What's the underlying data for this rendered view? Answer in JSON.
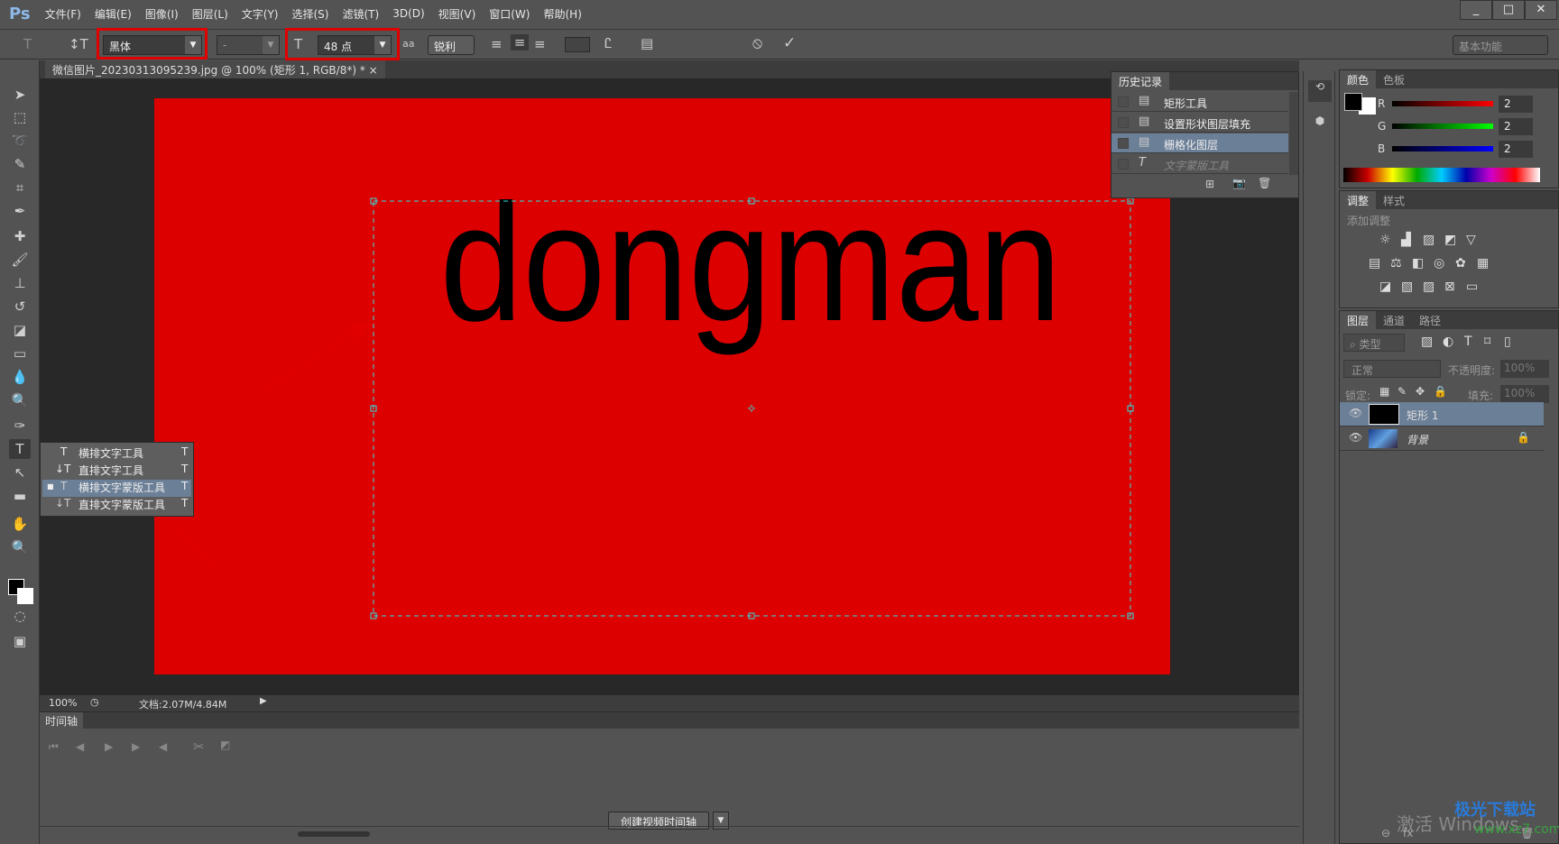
{
  "app": {
    "logo": "Ps"
  },
  "menu": [
    "文件(F)",
    "编辑(E)",
    "图像(I)",
    "图层(L)",
    "文字(Y)",
    "选择(S)",
    "滤镜(T)",
    "3D(D)",
    "视图(V)",
    "窗口(W)",
    "帮助(H)"
  ],
  "window_controls": {
    "minimize": "_",
    "maximize": "□",
    "close": "✕"
  },
  "options": {
    "font_family": "黑体",
    "font_style": "-",
    "font_size": "48 点",
    "antialias_icon": "aa",
    "antialias": "锐利",
    "workspace": "基本功能",
    "cancel": "⦸",
    "commit": "✓"
  },
  "document": {
    "tab_title": "微信图片_20230313095239.jpg @ 100% (矩形 1, RGB/8*) *",
    "tab_close": "×",
    "text": "dongman",
    "canvas_color": "#dc0000"
  },
  "status": {
    "zoom": "100%",
    "doc_size": "文档:2.07M/4.84M"
  },
  "timeline": {
    "tab": "时间轴",
    "create_button": "创建视频时间轴"
  },
  "tool_flyout": {
    "items": [
      {
        "icon": "T",
        "label": "横排文字工具",
        "key": "T",
        "selected": false
      },
      {
        "icon": "↓T",
        "label": "直排文字工具",
        "key": "T",
        "selected": false
      },
      {
        "icon": "T",
        "label": "横排文字蒙版工具",
        "key": "T",
        "selected": true
      },
      {
        "icon": "↓T",
        "label": "直排文字蒙版工具",
        "key": "T",
        "selected": false
      }
    ]
  },
  "history": {
    "title": "历史记录",
    "items": [
      {
        "label": "矩形工具",
        "selected": false
      },
      {
        "label": "设置形状图层填充",
        "selected": false
      },
      {
        "label": "栅格化图层",
        "selected": true
      },
      {
        "label": "文字蒙版工具",
        "selected": false,
        "disabled": true
      }
    ]
  },
  "color_panel": {
    "tabs": [
      "颜色",
      "色板"
    ],
    "channels": [
      {
        "name": "R",
        "value": "2"
      },
      {
        "name": "G",
        "value": "2"
      },
      {
        "name": "B",
        "value": "2"
      }
    ]
  },
  "adjust_panel": {
    "tabs": [
      "调整",
      "样式"
    ],
    "heading": "添加调整"
  },
  "layers_panel": {
    "tabs": [
      "图层",
      "通道",
      "路径"
    ],
    "filter": "类型",
    "blend_mode": "正常",
    "opacity_label": "不透明度:",
    "opacity": "100%",
    "lock_label": "锁定:",
    "fill_label": "填充:",
    "fill": "100%",
    "layers": [
      {
        "name": "矩形 1",
        "selected": true
      },
      {
        "name": "背景",
        "locked": true
      }
    ]
  },
  "watermark": {
    "text": "激活 Windows",
    "site": "极光下载站",
    "url": "www.xz7.com"
  }
}
